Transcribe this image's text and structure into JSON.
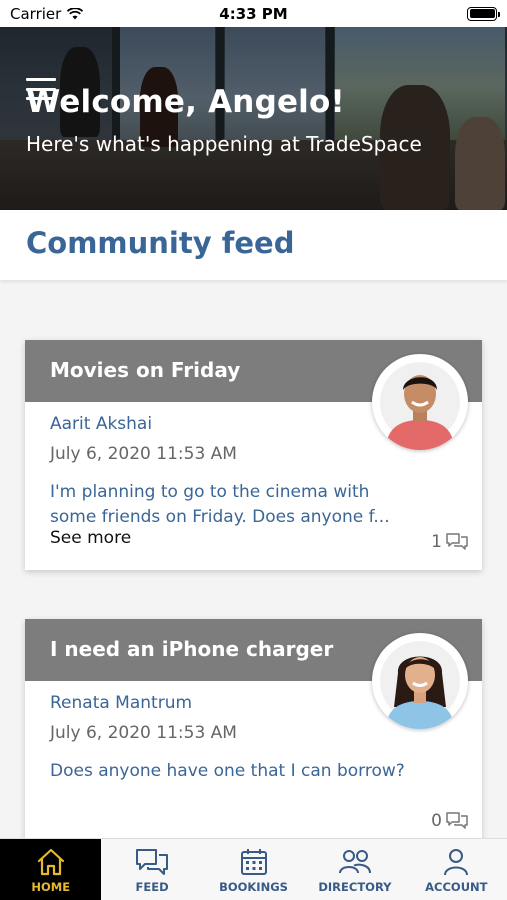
{
  "status_bar": {
    "carrier": "Carrier",
    "time": "4:33 PM"
  },
  "hero": {
    "title": "Welcome, Angelo!",
    "subtitle": "Here's what's happening at TradeSpace"
  },
  "feed": {
    "title": "Community feed",
    "posts": [
      {
        "title": "Movies on Friday",
        "author": "Aarit Akshai",
        "date": "July 6, 2020 11:53 AM",
        "body": "I'm planning to go to the cinema with some friends on Friday. Does anyone f...",
        "see_more": "See more",
        "comment_count": "1"
      },
      {
        "title": "I need an iPhone charger",
        "author": "Renata Mantrum",
        "date": "July 6, 2020 11:53 AM",
        "body": "Does anyone have one that I can borrow?",
        "comment_count": "0"
      }
    ]
  },
  "tab_bar": {
    "tabs": [
      {
        "label": "HOME",
        "icon": "home-icon",
        "active": true
      },
      {
        "label": "FEED",
        "icon": "chat-icon",
        "active": false
      },
      {
        "label": "BOOKINGS",
        "icon": "calendar-icon",
        "active": false
      },
      {
        "label": "DIRECTORY",
        "icon": "people-icon",
        "active": false
      },
      {
        "label": "ACCOUNT",
        "icon": "user-icon",
        "active": false
      }
    ]
  },
  "colors": {
    "accent_blue": "#3a6697",
    "active_tab_bg": "#000000",
    "active_tab_fg": "#e7b92c",
    "card_header": "#7d7d7d"
  }
}
